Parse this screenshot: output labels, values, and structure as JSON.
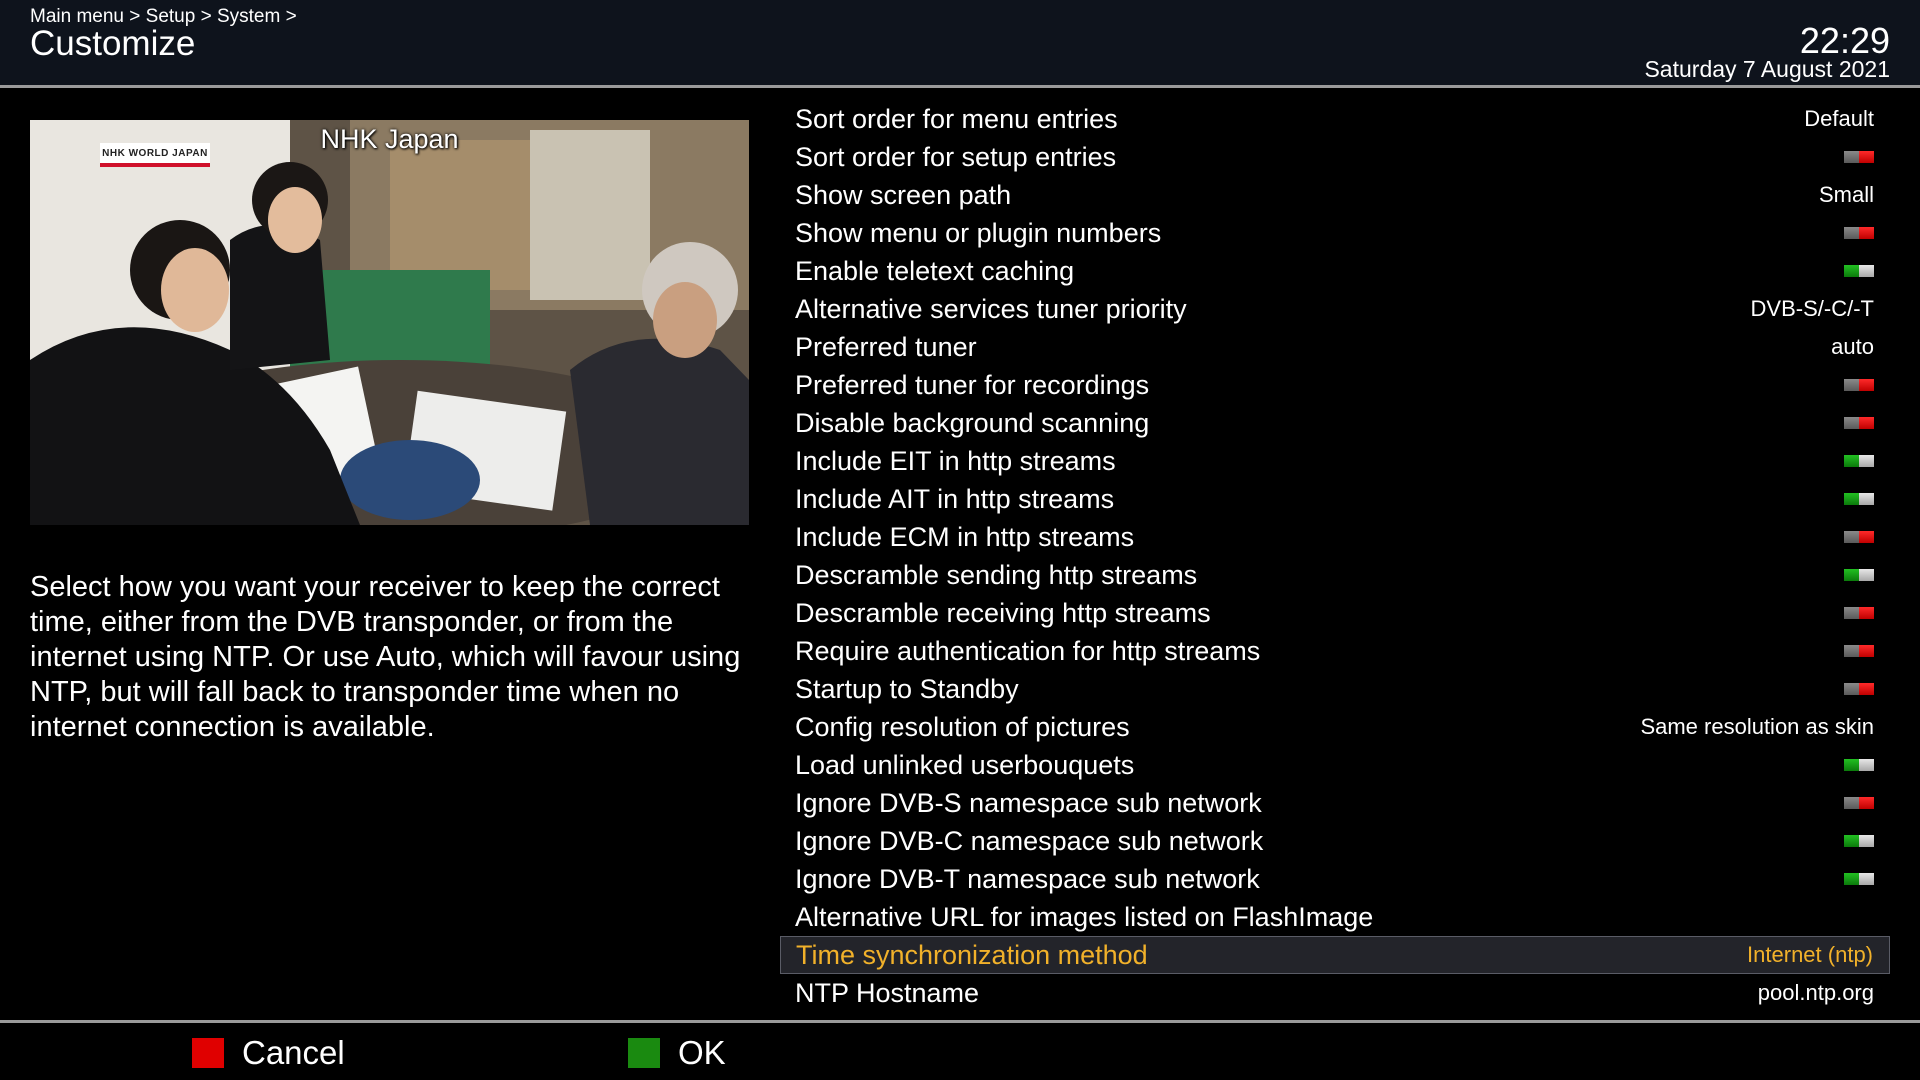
{
  "header": {
    "breadcrumb": "Main menu > Setup > System >",
    "title": "Customize",
    "time": "22:29",
    "date": "Saturday  7 August 2021"
  },
  "preview": {
    "channel_name": "NHK Japan",
    "logo_text": "NHK WORLD JAPAN"
  },
  "description": "Select how you want your receiver to keep the correct time, either from the DVB transponder, or from the internet using NTP. Or use Auto, which will favour using NTP, but will fall back to transponder time when no internet connection is available.",
  "settings": [
    {
      "label": "Sort order for menu entries",
      "value": "Default",
      "type": "text"
    },
    {
      "label": "Sort order for setup entries",
      "value": "off",
      "type": "toggle"
    },
    {
      "label": "Show screen path",
      "value": "Small",
      "type": "text"
    },
    {
      "label": "Show menu or plugin numbers",
      "value": "off",
      "type": "toggle"
    },
    {
      "label": "Enable teletext caching",
      "value": "on",
      "type": "toggle"
    },
    {
      "label": "Alternative services tuner priority",
      "value": "DVB-S/-C/-T",
      "type": "text"
    },
    {
      "label": "Preferred tuner",
      "value": "auto",
      "type": "text"
    },
    {
      "label": "Preferred tuner for recordings",
      "value": "off",
      "type": "toggle"
    },
    {
      "label": "Disable background scanning",
      "value": "off",
      "type": "toggle"
    },
    {
      "label": "Include EIT in http streams",
      "value": "on",
      "type": "toggle"
    },
    {
      "label": "Include AIT in http streams",
      "value": "on",
      "type": "toggle"
    },
    {
      "label": "Include ECM in http streams",
      "value": "off",
      "type": "toggle"
    },
    {
      "label": "Descramble sending http streams",
      "value": "on",
      "type": "toggle"
    },
    {
      "label": "Descramble receiving http streams",
      "value": "off",
      "type": "toggle"
    },
    {
      "label": "Require authentication for http streams",
      "value": "off",
      "type": "toggle"
    },
    {
      "label": "Startup to Standby",
      "value": "off",
      "type": "toggle"
    },
    {
      "label": "Config resolution of pictures",
      "value": "Same resolution as skin",
      "type": "text"
    },
    {
      "label": "Load unlinked userbouquets",
      "value": "on",
      "type": "toggle"
    },
    {
      "label": "Ignore DVB-S namespace sub network",
      "value": "off",
      "type": "toggle"
    },
    {
      "label": "Ignore DVB-C namespace sub network",
      "value": "on",
      "type": "toggle"
    },
    {
      "label": "Ignore DVB-T namespace sub network",
      "value": "on",
      "type": "toggle"
    },
    {
      "label": "Alternative URL for images listed on FlashImage",
      "value": "",
      "type": "text"
    },
    {
      "label": "Time synchronization method",
      "value": "Internet (ntp)",
      "type": "text",
      "selected": true
    },
    {
      "label": "NTP Hostname",
      "value": "pool.ntp.org",
      "type": "text"
    }
  ],
  "footer": {
    "cancel_label": "Cancel",
    "ok_label": "OK",
    "cancel_color": "#e00000",
    "ok_color": "#1a8a10"
  },
  "colors": {
    "selected_text": "#f1b12a",
    "header_bg": "#0e131c"
  }
}
